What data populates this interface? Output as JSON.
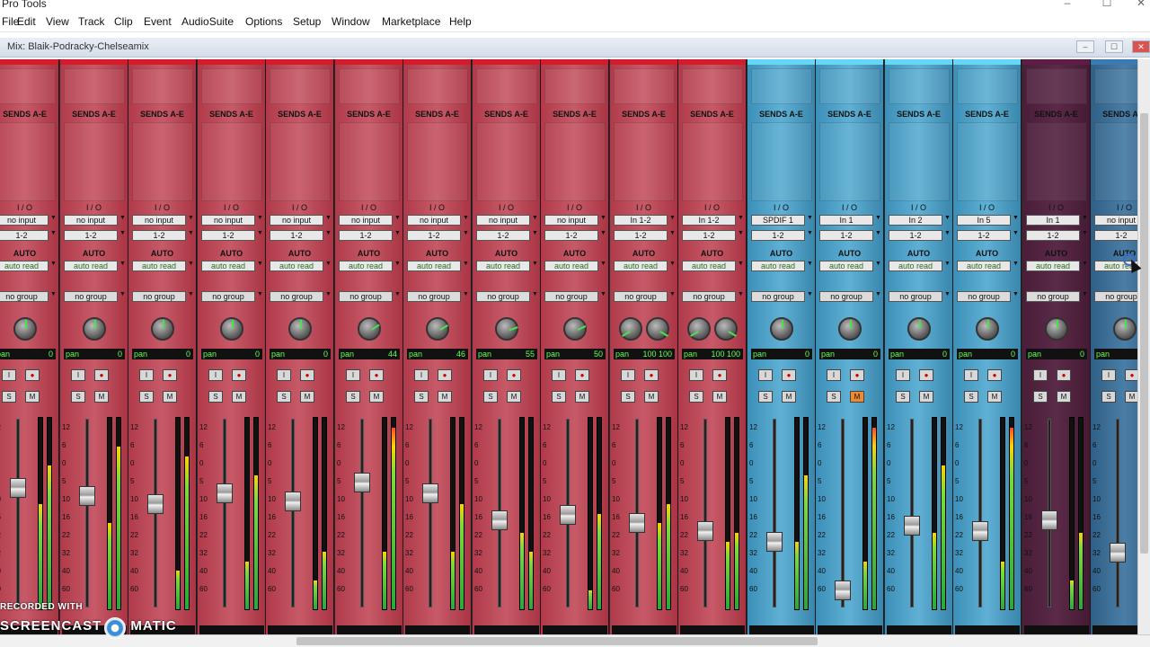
{
  "app": {
    "title": "Pro Tools"
  },
  "window_controls": {
    "minimize": "–",
    "maximize": "☐",
    "close": "✕"
  },
  "menu": [
    "File",
    "Edit",
    "View",
    "Track",
    "Clip",
    "Event",
    "AudioSuite",
    "Options",
    "Setup",
    "Window",
    "Marketplace",
    "Help"
  ],
  "mix_window": {
    "title": "Mix: Blaik-Podracky-Chelseamix"
  },
  "labels": {
    "sends": "SENDS A-E",
    "io": "I / O",
    "auto": "AUTO",
    "pan": "pan",
    "input_btn": "I",
    "rec_btn": "●",
    "solo_btn": "S",
    "mute_btn": "M"
  },
  "scale": [
    "12",
    "6",
    "0",
    "5",
    "10",
    "16",
    "22",
    "32",
    "40",
    "60"
  ],
  "strips": [
    {
      "color": "red",
      "input": "no input",
      "output": "1-2",
      "auto": "auto read",
      "group": "no group",
      "pan": "0",
      "muted": false
    },
    {
      "color": "red",
      "input": "no input",
      "output": "1-2",
      "auto": "auto read",
      "group": "no group",
      "pan": "0",
      "muted": false
    },
    {
      "color": "red",
      "input": "no input",
      "output": "1-2",
      "auto": "auto read",
      "group": "no group",
      "pan": "0",
      "muted": false
    },
    {
      "color": "red",
      "input": "no input",
      "output": "1-2",
      "auto": "auto read",
      "group": "no group",
      "pan": "0",
      "muted": false
    },
    {
      "color": "red",
      "input": "no input",
      "output": "1-2",
      "auto": "auto read",
      "group": "no group",
      "pan": "0",
      "muted": false
    },
    {
      "color": "red",
      "input": "no input",
      "output": "1-2",
      "auto": "auto read",
      "group": "no group",
      "pan": "44",
      "muted": false
    },
    {
      "color": "red",
      "input": "no input",
      "output": "1-2",
      "auto": "auto read",
      "group": "no group",
      "pan": "46",
      "muted": false
    },
    {
      "color": "red",
      "input": "no input",
      "output": "1-2",
      "auto": "auto read",
      "group": "no group",
      "pan": "55",
      "muted": false
    },
    {
      "color": "red",
      "input": "no input",
      "output": "1-2",
      "auto": "auto read",
      "group": "no group",
      "pan": "50",
      "muted": false
    },
    {
      "color": "red",
      "input": "In 1-2",
      "output": "1-2",
      "auto": "auto read",
      "group": "no group",
      "pan": "100 100",
      "muted": false
    },
    {
      "color": "red",
      "input": "In 1-2",
      "output": "1-2",
      "auto": "auto read",
      "group": "no group",
      "pan": "100 100",
      "muted": false
    },
    {
      "color": "blue",
      "input": "SPDIF 1",
      "output": "1-2",
      "auto": "auto read",
      "group": "no group",
      "pan": "0",
      "muted": false
    },
    {
      "color": "blue",
      "input": "In 1",
      "output": "1-2",
      "auto": "auto read",
      "group": "no group",
      "pan": "0",
      "muted": true
    },
    {
      "color": "blue",
      "input": "In 2",
      "output": "1-2",
      "auto": "auto read",
      "group": "no group",
      "pan": "0",
      "muted": false
    },
    {
      "color": "blue",
      "input": "In 5",
      "output": "1-2",
      "auto": "auto read",
      "group": "no group",
      "pan": "0",
      "muted": false
    },
    {
      "color": "purple",
      "input": "In 1",
      "output": "1-2",
      "auto": "auto read",
      "group": "no group",
      "pan": "0",
      "muted": false
    },
    {
      "color": "slate",
      "input": "no input",
      "output": "1-2",
      "auto": "auto read",
      "group": "no group",
      "pan": "0",
      "muted": false
    }
  ],
  "fader_levels": [
    0.38,
    0.35,
    0.32,
    0.36,
    0.33,
    0.4,
    0.36,
    0.26,
    0.28,
    0.25,
    0.22,
    0.18,
    0.0,
    0.24,
    0.22,
    0.26,
    0.14
  ],
  "meter_levels": [
    [
      0.55,
      0.75
    ],
    [
      0.45,
      0.85
    ],
    [
      0.2,
      0.8
    ],
    [
      0.25,
      0.7
    ],
    [
      0.15,
      0.3
    ],
    [
      0.3,
      0.95
    ],
    [
      0.3,
      0.55
    ],
    [
      0.4,
      0.3
    ],
    [
      0.1,
      0.5
    ],
    [
      0.45,
      0.55
    ],
    [
      0.35,
      0.4
    ],
    [
      0.35,
      0.7
    ],
    [
      0.25,
      0.95
    ],
    [
      0.4,
      0.75
    ],
    [
      0.25,
      0.95
    ],
    [
      0.15,
      0.4
    ],
    [
      0.1,
      0.2
    ]
  ],
  "watermark": {
    "line1": "RECORDED WITH",
    "line2": "SCREENCAST",
    "line3": "MATIC"
  }
}
